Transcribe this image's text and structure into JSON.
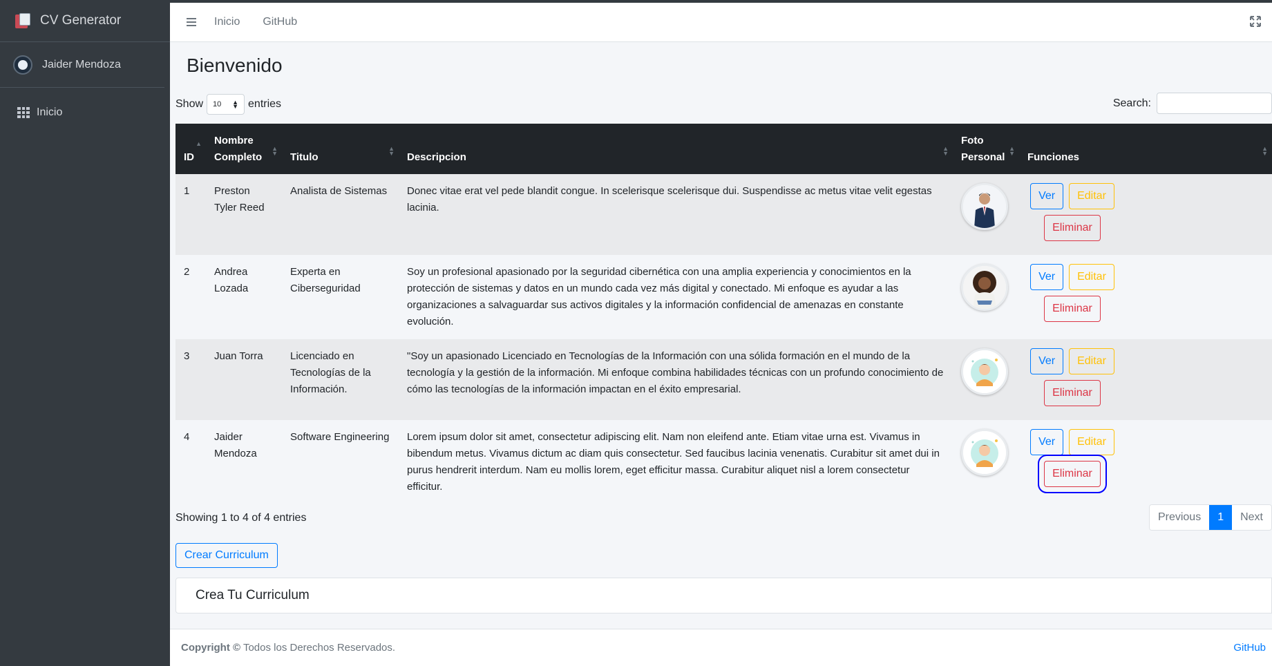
{
  "app": {
    "brand": "CV Generator",
    "user": "Jaider Mendoza"
  },
  "sidebar": {
    "items": [
      {
        "label": "Inicio",
        "icon": "grid-icon"
      }
    ]
  },
  "header": {
    "links": [
      "Inicio",
      "GitHub"
    ]
  },
  "page": {
    "title": "Bienvenido"
  },
  "table_controls": {
    "show_label": "Show",
    "entries_value": "10",
    "entries_label": "entries",
    "search_label": "Search:",
    "search_value": ""
  },
  "table": {
    "columns": [
      "ID",
      "Nombre Completo",
      "Titulo",
      "Descripcion",
      "Foto Personal",
      "Funciones"
    ],
    "rows": [
      {
        "id": "1",
        "name": "Preston Tyler Reed",
        "title": "Analista de Sistemas",
        "description": "Donec vitae erat vel pede blandit congue. In scelerisque scelerisque dui. Suspendisse ac metus vitae velit egestas lacinia.",
        "photo": "man-in-suit-photo"
      },
      {
        "id": "2",
        "name": "Andrea Lozada",
        "title": "Experta en Ciberseguridad",
        "description": "Soy un profesional apasionado por la seguridad cibernética con una amplia experiencia y conocimientos en la protección de sistemas y datos en un mundo cada vez más digital y conectado. Mi enfoque es ayudar a las organizaciones a salvaguardar sus activos digitales y la información confidencial de amenazas en constante evolución.",
        "photo": "woman-photo"
      },
      {
        "id": "3",
        "name": "Juan Torra",
        "title": "Licenciado en Tecnologías de la Información.",
        "description": "\"Soy un apasionado Licenciado en Tecnologías de la Información con una sólida formación en el mundo de la tecnología y la gestión de la información. Mi enfoque combina habilidades técnicas con un profundo conocimiento de cómo las tecnologías de la información impactan en el éxito empresarial.",
        "photo": "cartoon-avatar"
      },
      {
        "id": "4",
        "name": "Jaider Mendoza",
        "title": "Software Engineering",
        "description": "Lorem ipsum dolor sit amet, consectetur adipiscing elit. Nam non eleifend ante. Etiam vitae urna est. Vivamus in bibendum metus. Vivamus dictum ac diam quis consectetur. Sed faucibus lacinia venenatis. Curabitur sit amet dui in purus hendrerit interdum. Nam eu mollis lorem, eget efficitur massa. Curabitur aliquet nisl a lorem consectetur efficitur.",
        "photo": "cartoon-avatar"
      }
    ],
    "actions": {
      "view": "Ver",
      "edit": "Editar",
      "delete": "Eliminar"
    }
  },
  "pagination": {
    "info": "Showing 1 to 4 of 4 entries",
    "previous": "Previous",
    "current": "1",
    "next": "Next"
  },
  "create_button": "Crear Curriculum",
  "card": {
    "title": "Crea Tu Curriculum"
  },
  "footer": {
    "copyright": "Copyright ©",
    "rights": "Todos los Derechos Reservados.",
    "link": "GitHub"
  },
  "colors": {
    "sidebar": "#343a40",
    "primary": "#007bff",
    "warning": "#ffc107",
    "danger": "#dc3545",
    "highlight": "#0000ff"
  }
}
